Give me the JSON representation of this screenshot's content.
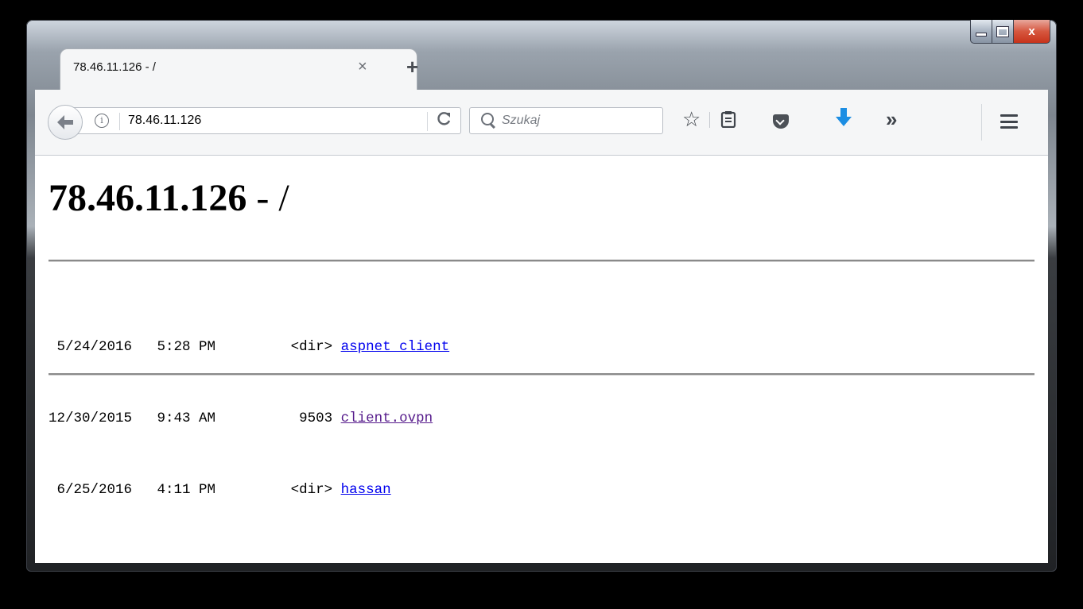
{
  "window": {
    "controls": {
      "minimize_icon": "minimize-icon",
      "maximize_icon": "maximize-icon",
      "close_label": "x"
    }
  },
  "tab": {
    "title": "78.46.11.126 - /",
    "close_label": "×",
    "new_tab_label": "+"
  },
  "toolbar": {
    "back_icon": "back-arrow-icon",
    "info_label": "i",
    "url": "78.46.11.126",
    "reload_label": "C",
    "search_placeholder": "Szukaj",
    "overflow_label": "»"
  },
  "page": {
    "title": "78.46.11.126",
    "title_suffix": " - /",
    "entries": [
      {
        "date": " 5/24/2016",
        "time": " 5:28 PM",
        "size": "<dir>",
        "name": "aspnet_client",
        "visited": false
      },
      {
        "date": "12/30/2015",
        "time": " 9:43 AM",
        "size": " 9503",
        "name": "client.ovpn",
        "visited": true
      },
      {
        "date": " 6/25/2016",
        "time": " 4:11 PM",
        "size": "<dir>",
        "name": "hassan",
        "visited": false
      }
    ]
  },
  "colors": {
    "link": "#0000ee",
    "visited_link": "#551a8b",
    "download_icon": "#1c8ee3",
    "close_button": "#c7331b"
  }
}
